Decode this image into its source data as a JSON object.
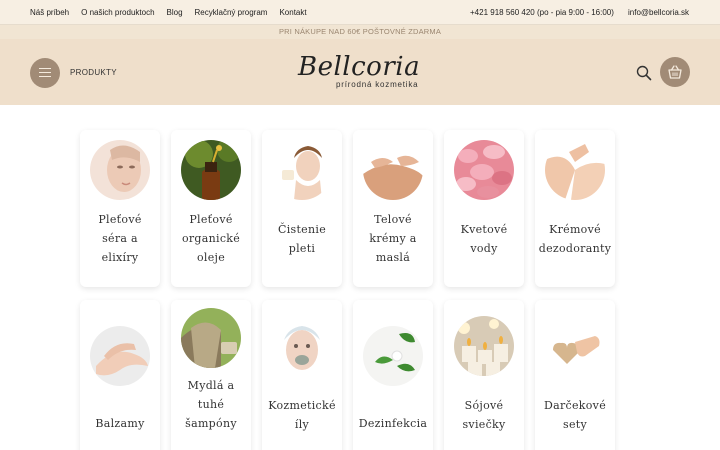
{
  "topbar": {
    "nav": [
      "Náš príbeh",
      "O našich produktoch",
      "Blog",
      "Recyklačný program",
      "Kontakt"
    ],
    "phone": "+421 918 560 420 (po - pia 9:00 - 16:00)",
    "email": "info@bellcoria.sk"
  },
  "promo": "PRI NÁKUPE NAD 60€ POŠTOVNÉ ZDARMA",
  "header": {
    "menu_label": "PRODUKTY",
    "logo_text": "Bellcoria",
    "logo_sub": "prírodná kozmetika",
    "icons": {
      "menu": "hamburger-icon",
      "search": "search-icon",
      "cart": "basket-icon"
    },
    "colors": {
      "accent": "#a18b76",
      "header_bg": "#efdfcb",
      "topbar_bg": "#f7efe3"
    }
  },
  "categories": [
    {
      "label": "Pleťové\nséra a\nelixíry"
    },
    {
      "label": "Pleťové\norganické\noleje"
    },
    {
      "label": "Čistenie\npleti"
    },
    {
      "label": "Telové\nkrémy a\nmaslá"
    },
    {
      "label": "Kvetové\nvody"
    },
    {
      "label": "Krémové\ndezodoranty"
    },
    {
      "label": "Balzamy"
    },
    {
      "label": "Mydlá a\ntuhé\nšampóny"
    },
    {
      "label": "Kozmetické\níly"
    },
    {
      "label": "Dezinfekcia"
    },
    {
      "label": "Sójové\nsviečky"
    },
    {
      "label": "Darčekové\nsety"
    }
  ]
}
